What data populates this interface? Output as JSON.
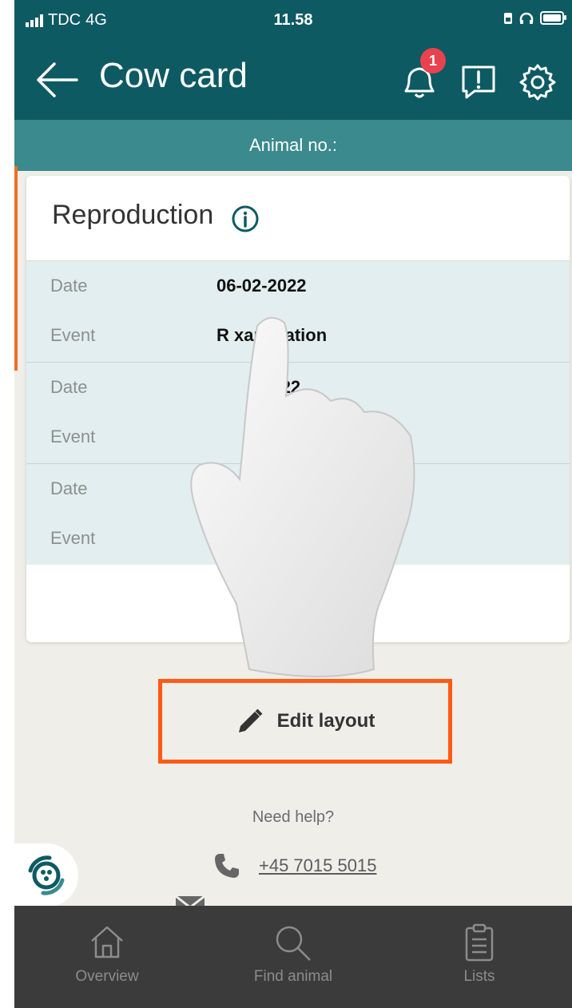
{
  "status_bar": {
    "carrier": "TDC",
    "network": "4G",
    "time": "11.58"
  },
  "app_bar": {
    "title": "Cow card",
    "notification_count": "1"
  },
  "sub_header": {
    "label": "Animal no.:"
  },
  "card": {
    "title": "Reproduction",
    "events": [
      {
        "date_label": "Date",
        "date_value": "06-02-2022",
        "event_label": "Event",
        "event_value": "R        xamination"
      },
      {
        "date_label": "Date",
        "date_value": "        -2022",
        "event_label": "Event",
        "event_value": ""
      },
      {
        "date_label": "Date",
        "date_value": "",
        "event_label": "Event",
        "event_value": ""
      }
    ]
  },
  "edit_button": {
    "label": "Edit layout"
  },
  "help": {
    "title": "Need help?",
    "phone": "+45 7015 5015"
  },
  "tabs": [
    {
      "label": "Overview",
      "icon": "home-icon"
    },
    {
      "label": "Find animal",
      "icon": "search-icon"
    },
    {
      "label": "Lists",
      "icon": "clipboard-icon"
    }
  ],
  "colors": {
    "header": "#0d5a63",
    "subheader": "#3a8a8e",
    "highlight": "#ff5a14",
    "badge": "#e8424e",
    "tab_bar": "#3b3b3b"
  }
}
